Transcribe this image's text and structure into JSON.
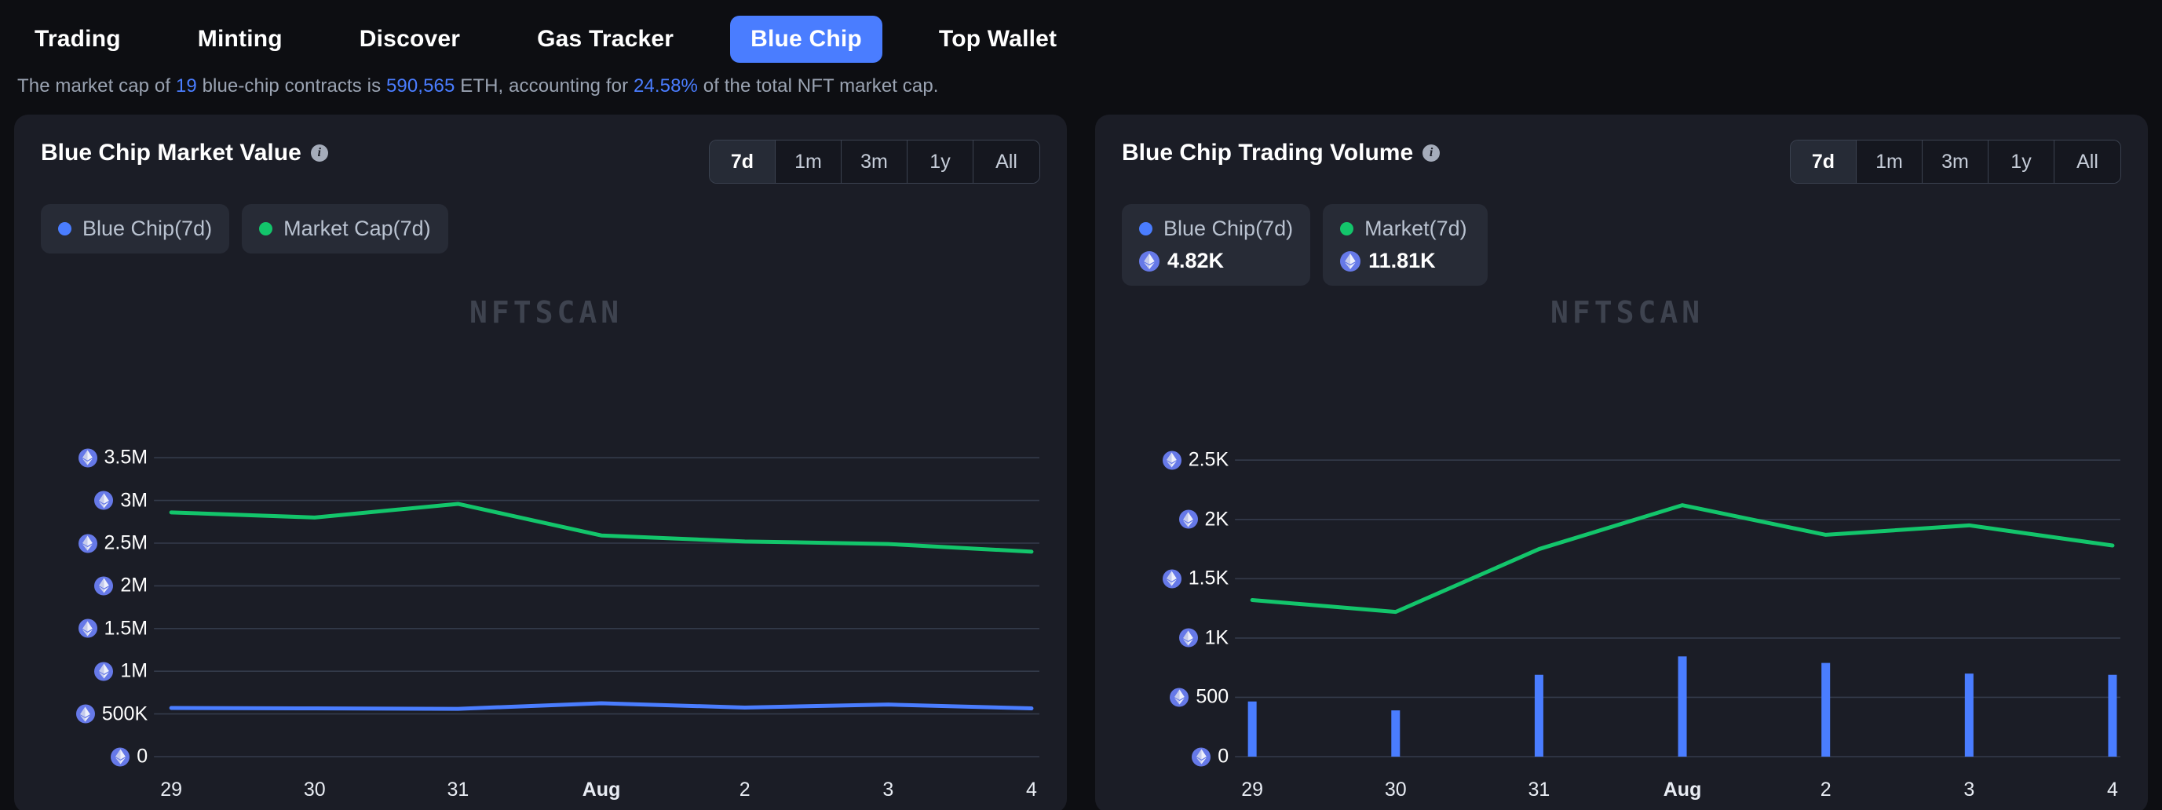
{
  "nav": {
    "items": [
      {
        "label": "Trading",
        "active": false
      },
      {
        "label": "Minting",
        "active": false
      },
      {
        "label": "Discover",
        "active": false
      },
      {
        "label": "Gas Tracker",
        "active": false
      },
      {
        "label": "Blue Chip",
        "active": true
      },
      {
        "label": "Top Wallet",
        "active": false
      }
    ]
  },
  "subtitle": {
    "part1": "The market cap of ",
    "count": "19",
    "part2": " blue-chip contracts is ",
    "marketcap": "590,565",
    "part3": " ETH, accounting for ",
    "percent": "24.58%",
    "part4": " of the total NFT market cap."
  },
  "watermark": "NFTSCAN",
  "accent": {
    "blue": "#4a7dff",
    "green": "#13c56b",
    "eth_badge": "#6679e8",
    "card_bg": "#1b1d26",
    "page_bg": "#0d0e12"
  },
  "range_options": [
    {
      "label": "7d",
      "active": true
    },
    {
      "label": "1m",
      "active": false
    },
    {
      "label": "3m",
      "active": false
    },
    {
      "label": "1y",
      "active": false
    },
    {
      "label": "All",
      "active": false
    }
  ],
  "left_card": {
    "title": "Blue Chip Market Value",
    "info_glyph": "i",
    "legend": [
      {
        "label": "Blue Chip(7d)",
        "color": "blue",
        "value": null
      },
      {
        "label": "Market Cap(7d)",
        "color": "green",
        "value": null
      }
    ]
  },
  "right_card": {
    "title": "Blue Chip Trading Volume",
    "info_glyph": "i",
    "legend": [
      {
        "label": "Blue Chip(7d)",
        "color": "blue",
        "value": "4.82K"
      },
      {
        "label": "Market(7d)",
        "color": "green",
        "value": "11.81K"
      }
    ]
  },
  "chart_data": [
    {
      "type": "line",
      "title": "Blue Chip Market Value",
      "xlabel": "",
      "ylabel": "ETH",
      "grid": true,
      "legend_position": "top-left",
      "categories": [
        "29",
        "30",
        "31",
        "Aug",
        "2",
        "3",
        "4"
      ],
      "x_tick_bold": [
        "Aug"
      ],
      "y_ticks": [
        0,
        500000,
        1000000,
        1500000,
        2000000,
        2500000,
        3000000,
        3500000
      ],
      "y_tick_labels": [
        "0",
        "500K",
        "1M",
        "1.5M",
        "2M",
        "2.5M",
        "3M",
        "3.5M"
      ],
      "ylim": [
        0,
        3750000
      ],
      "series": [
        {
          "name": "Blue Chip(7d)",
          "color": "#4a7dff",
          "values": [
            570000,
            565000,
            560000,
            625000,
            575000,
            610000,
            565000
          ]
        },
        {
          "name": "Market Cap(7d)",
          "color": "#13c56b",
          "values": [
            2860000,
            2800000,
            2960000,
            2590000,
            2520000,
            2490000,
            2400000
          ]
        }
      ]
    },
    {
      "type": "bar+line",
      "title": "Blue Chip Trading Volume",
      "xlabel": "",
      "ylabel": "ETH",
      "grid": true,
      "legend_position": "top-left",
      "categories": [
        "29",
        "30",
        "31",
        "Aug",
        "2",
        "3",
        "4"
      ],
      "x_tick_bold": [
        "Aug"
      ],
      "y_ticks": [
        0,
        500,
        1000,
        1500,
        2000,
        2500
      ],
      "y_tick_labels": [
        "0",
        "500",
        "1K",
        "1.5K",
        "2K",
        "2.5K"
      ],
      "ylim": [
        0,
        2700
      ],
      "series": [
        {
          "name": "Blue Chip(7d)",
          "type": "bar",
          "color": "#4a7dff",
          "values": [
            465,
            390,
            690,
            845,
            790,
            700,
            690
          ]
        },
        {
          "name": "Market(7d)",
          "type": "line",
          "color": "#13c56b",
          "values": [
            1320,
            1220,
            1750,
            2120,
            1870,
            1950,
            1780
          ]
        }
      ]
    }
  ]
}
